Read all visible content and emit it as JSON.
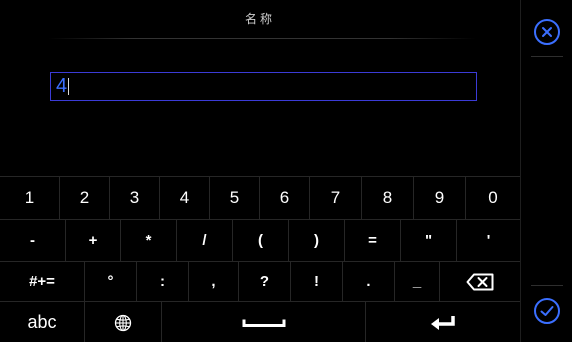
{
  "dialog": {
    "title": "名称",
    "input_value": "4"
  },
  "keyboard": {
    "row1": [
      "1",
      "2",
      "3",
      "4",
      "5",
      "6",
      "7",
      "8",
      "9",
      "0"
    ],
    "row2": [
      "-",
      "+",
      "*",
      "/",
      "(",
      ")",
      "=",
      "\"",
      "'"
    ],
    "row3": [
      "#+=",
      "°",
      ":",
      ",",
      "?",
      "!",
      ".",
      "_"
    ],
    "mode_key": "abc"
  },
  "icons": {
    "close": "close-circle-icon",
    "confirm": "check-circle-icon",
    "backspace": "backspace-icon",
    "globe": "globe-icon",
    "space": "space-bar-icon",
    "enter": "enter-icon"
  },
  "colors": {
    "background": "#000000",
    "accent": "#3b6fff",
    "input_border": "#3b3bd6",
    "key_divider": "#262626"
  }
}
